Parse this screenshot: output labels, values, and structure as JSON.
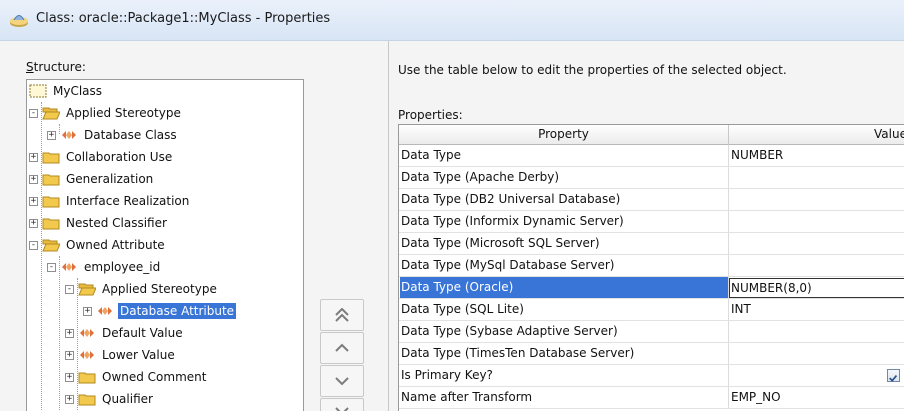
{
  "window": {
    "title": "Class: oracle::Package1::MyClass - Properties"
  },
  "structure": {
    "label": "Structure:",
    "tree": [
      {
        "label": "MyClass",
        "icon": "class-icon",
        "expander": ""
      },
      {
        "label": "Applied Stereotype",
        "icon": "folder-open-icon",
        "expander": "-"
      },
      {
        "label": "Database Class",
        "icon": "stereotype-icon",
        "expander": "+"
      },
      {
        "label": "Collaboration Use",
        "icon": "folder-icon",
        "expander": "+"
      },
      {
        "label": "Generalization",
        "icon": "folder-icon",
        "expander": "+"
      },
      {
        "label": "Interface Realization",
        "icon": "folder-icon",
        "expander": "+"
      },
      {
        "label": "Nested Classifier",
        "icon": "folder-icon",
        "expander": "+"
      },
      {
        "label": "Owned Attribute",
        "icon": "folder-open-icon",
        "expander": "-"
      },
      {
        "label": "employee_id",
        "icon": "stereotype-icon",
        "expander": "-"
      },
      {
        "label": "Applied Stereotype",
        "icon": "folder-open-icon",
        "expander": "-"
      },
      {
        "label": "Database Attribute",
        "icon": "stereotype-icon",
        "expander": "+",
        "selected": true
      },
      {
        "label": "Default Value",
        "icon": "stereotype-icon",
        "expander": "+"
      },
      {
        "label": "Lower Value",
        "icon": "stereotype-icon",
        "expander": "+"
      },
      {
        "label": "Owned Comment",
        "icon": "folder-icon",
        "expander": "+"
      },
      {
        "label": "Qualifier",
        "icon": "folder-icon",
        "expander": "+"
      }
    ]
  },
  "move_buttons": [
    {
      "icon": "move-top-icon"
    },
    {
      "icon": "move-up-icon"
    },
    {
      "icon": "move-down-icon"
    },
    {
      "icon": "move-bottom-icon"
    }
  ],
  "properties": {
    "instructions": "Use the table below to edit the properties of the selected object.",
    "label": "Properties:",
    "columns": {
      "property": "Property",
      "value": "Value"
    },
    "rows": [
      {
        "property": "Data Type",
        "value": "NUMBER"
      },
      {
        "property": "Data Type (Apache Derby)",
        "value": ""
      },
      {
        "property": "Data Type (DB2 Universal Database)",
        "value": ""
      },
      {
        "property": "Data Type (Informix Dynamic Server)",
        "value": ""
      },
      {
        "property": "Data Type (Microsoft SQL Server)",
        "value": ""
      },
      {
        "property": "Data Type (MySql Database Server)",
        "value": ""
      },
      {
        "property": "Data Type (Oracle)",
        "value": "NUMBER(8,0)",
        "selected": true,
        "editing": true
      },
      {
        "property": "Data Type (SQL Lite)",
        "value": "INT"
      },
      {
        "property": "Data Type (Sybase Adaptive Server)",
        "value": ""
      },
      {
        "property": "Data Type (TimesTen Database Server)",
        "value": ""
      },
      {
        "property": "Is Primary Key?",
        "value": "",
        "checkbox": true,
        "checked": true
      },
      {
        "property": "Name after Transform",
        "value": "EMP_NO"
      }
    ]
  },
  "colors": {
    "selection": "#3875d7",
    "folder": "#f2c94c",
    "stereotype": "#e0703a"
  }
}
